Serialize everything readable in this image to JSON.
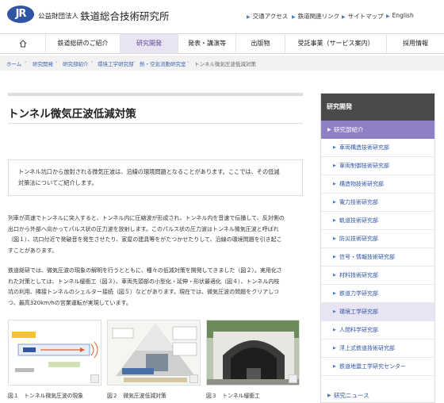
{
  "header": {
    "logo_text": "JR",
    "org_type": "公益財団法人",
    "org_name": "鉄道総合技術研究所",
    "utility_links": [
      "交通アクセス",
      "鉄道関連リンク",
      "サイトマップ",
      "English"
    ]
  },
  "nav": {
    "items": [
      "鉄道総研のご紹介",
      "研究開発",
      "発表・講演等",
      "出版物",
      "受託事業（サービス案内）",
      "採用情報"
    ],
    "active": "研究開発"
  },
  "breadcrumb": [
    "ホーム",
    "研究開発",
    "研究部紹介",
    "環境工学研究部",
    "熱・空気流動研究室",
    "トンネル微気圧波低減対策"
  ],
  "page": {
    "title": "トンネル微気圧波低減対策",
    "intro_lines": [
      "トンネル坑口から放射される微気圧波は、沿線の環境問題となることがあります。ここでは、その低減",
      "対策法についてご紹介します。"
    ],
    "para1_lines": [
      "列車が高速でトンネルに突入すると、トンネル内に圧縮波が形成され、トンネル内を音速で伝播して、反対側の",
      "出口から外部へ向かってパルス状の圧力波を放射します。このパルス状の圧力波はトンネル微気圧波と呼ばれ",
      "（図１）、坑口付近で発破音を発生させたり、家屋の建具等をがたつかせたりして、沿線の環境問題を引き起こ",
      "すことがあります。"
    ],
    "para2_lines": [
      "鉄道総研では、微気圧波の現象の解明を行うとともに、種々の低減対策を開発してきました（図２）。実用化さ",
      "れた対策としては、トンネル緩衝工（図３）、車両先頭部の小型化・延伸・形状最適化（図４）、トンネル内枝",
      "坑の利用、隣接トンネルのシェルター接続（図５）などがあります。現在では、微気圧波の問題をクリアしつ",
      "つ、最高320km/hの営業運転が実現しています。"
    ],
    "figures": [
      {
        "caption": "図１　トンネル微気圧波の現象"
      },
      {
        "caption": "図２　微気圧波低減対策"
      },
      {
        "caption": "図３　トンネル緩衝工"
      }
    ]
  },
  "sidebar": {
    "heading": "研究開発",
    "section": "研究部紹介",
    "items": [
      "車両構造技術研究部",
      "車両制御技術研究部",
      "構造物技術研究部",
      "電力技術研究部",
      "軌道技術研究部",
      "防災技術研究部",
      "信号・情報技術研究部",
      "材料技術研究部",
      "鉄道力学研究部",
      "環境工学研究部",
      "人間科学研究部",
      "浮上式鉄道技術研究部",
      "鉄道地震工学研究センター"
    ],
    "active_item": "環境工学研究部",
    "news": "研究ニュース"
  },
  "colors": {
    "brand_blue": "#2f55a4",
    "nav_active_bg": "#e9e4f3",
    "sidebar_section_bg": "#8f7fc4",
    "sidebar_head_bg": "#4a4a4a",
    "link": "#3b66b0"
  },
  "icons": {
    "home": "home-icon",
    "zoom": "magnifier-icon",
    "arrow": "triangle-right-icon"
  }
}
